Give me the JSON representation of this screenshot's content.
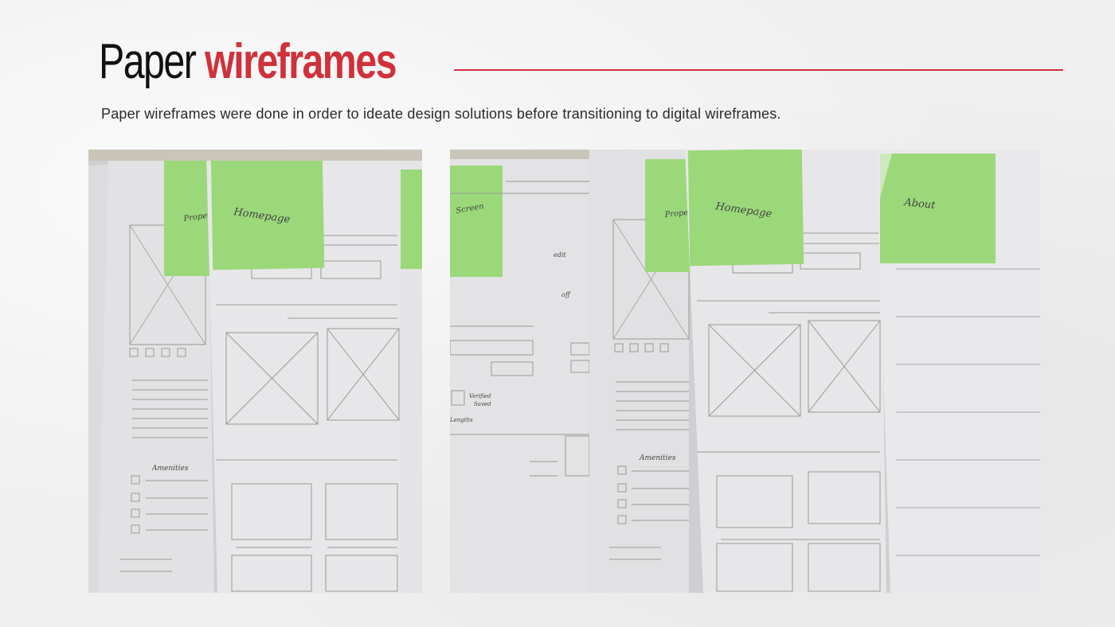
{
  "header": {
    "title_plain": "Paper",
    "title_accent": "wireframes",
    "subtitle": "Paper wireframes were done in order to ideate design solutions before transitioning to digital wireframes."
  },
  "colors": {
    "accent": "#d0313a",
    "sticky_note": "#9bd87a",
    "paper": "#e6e6e8"
  },
  "photos": [
    {
      "sticky_labels": [
        "Propert",
        "Homepage"
      ],
      "section_label": "Amenities"
    },
    {
      "sticky_labels": [
        "Screen",
        "Proper",
        "Homepage",
        "About"
      ],
      "section_label": "Amenities",
      "small_labels": [
        "edit",
        "off",
        "Verified",
        "Saved",
        "Lengths"
      ]
    }
  ]
}
